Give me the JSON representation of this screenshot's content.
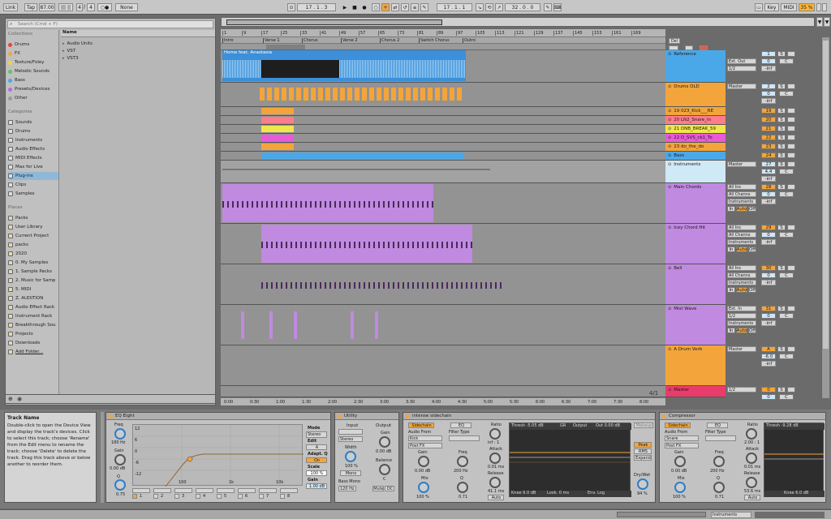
{
  "transport": {
    "link": "Link",
    "tap": "Tap",
    "tempo": "87.00",
    "bars": "||| ||",
    "sig_num": "4",
    "sig_den": "4",
    "metro": "None",
    "position": "17 . 1 . 3",
    "loop_start": "17 . 1 . 1",
    "loop_len": "32 . 0 . 0",
    "key": "Key",
    "midi": "MIDI",
    "cpu": "35 %",
    "accent": "#f3a53b"
  },
  "browser": {
    "search_placeholder": "Search (Cmd + F)",
    "collections_title": "Collections",
    "collections": [
      {
        "label": "Drums",
        "color": "#e8453c"
      },
      {
        "label": "FX",
        "color": "#f3a53b"
      },
      {
        "label": "Texture/Foley",
        "color": "#f0d43a"
      },
      {
        "label": "Melodic Sounds",
        "color": "#5dc461"
      },
      {
        "label": "Bass",
        "color": "#4aa8e8"
      },
      {
        "label": "Presets/Devices",
        "color": "#b070d8"
      },
      {
        "label": "Other",
        "color": "#9a9a9a"
      }
    ],
    "categories_title": "Categories",
    "categories": [
      "Sounds",
      "Drums",
      "Instruments",
      "Audio Effects",
      "MIDI Effects",
      "Max for Live",
      "Plug-ins",
      "Clips",
      "Samples"
    ],
    "places_title": "Places",
    "places": [
      "Packs",
      "User Library",
      "Current Project",
      "packs",
      "2020",
      "0. My Samples",
      "1. Sample Packs",
      "2. Music for Samp",
      "5. MIDI",
      "Z. AUDITION",
      "Audio Effect Rack",
      "Instrument Rack",
      "Breakthrough Sou",
      "Projects",
      "Downloads",
      "Add Folder..."
    ],
    "name_header": "Name",
    "files": [
      "Audio Units",
      "VST",
      "VST3"
    ]
  },
  "ruler": {
    "bars": [
      "1",
      "9",
      "17",
      "25",
      "33",
      "41",
      "49",
      "57",
      "65",
      "73",
      "81",
      "89",
      "97",
      "105",
      "113",
      "121",
      "129",
      "137",
      "145",
      "153",
      "161",
      "169"
    ],
    "locators": [
      "Intro",
      "Verse 1",
      "Chorus",
      "Verse 2",
      "Chorus 2",
      "Switch Chorus",
      "Outro"
    ],
    "times": [
      "0:00",
      "0:30",
      "1:00",
      "1:30",
      "2:00",
      "2:30",
      "3:00",
      "3:30",
      "4:00",
      "4:30",
      "5:00",
      "5:30",
      "6:00",
      "6:30",
      "7:00",
      "7:30",
      "8:00"
    ],
    "page": "4/1"
  },
  "clip_title": "Home feat. Anastasia",
  "tracks": [
    {
      "name": "Reference",
      "color": "#4aa8e8",
      "num": "1",
      "routing": "",
      "sub": "Ext. Out",
      "sub2": "1/2",
      "vol": "0",
      "pan": "C",
      "inf": "-inf"
    },
    {
      "name": "Drums OLD",
      "color": "#f3a53b",
      "num": "2",
      "routing": "Master",
      "vol": "0",
      "pan": "C",
      "inf": "-inf"
    },
    {
      "name": "19 023_Kick___RE",
      "color": "#f3a53b",
      "num": "19"
    },
    {
      "name": "20 LN2_Snare_In",
      "color": "#ff7d8b",
      "num": "20"
    },
    {
      "name": "21 DNB_BREAK_59",
      "color": "#f0e84a",
      "num": "21"
    },
    {
      "name": "22 D_SVS_ck1_To",
      "color": "#e85ad8",
      "num": "22"
    },
    {
      "name": "23 do_the_do",
      "color": "#f3a53b",
      "num": "23"
    },
    {
      "name": "Bass",
      "color": "#4aa8e8",
      "num": "24"
    },
    {
      "name": "Instruments",
      "color": "#cfe9f7",
      "num": "27",
      "routing": "Master",
      "vol": "4.4",
      "pan": "C",
      "inf": "-inf"
    },
    {
      "name": "Main Chords",
      "color": "#c08ae0",
      "num": "28",
      "routing": "All Ins",
      "sub": "All Channs",
      "sub2": "Instruments",
      "vol": "0",
      "pan": "C",
      "inf": "-inf"
    },
    {
      "name": "Icey Chord Hit",
      "color": "#c08ae0",
      "num": "29",
      "routing": "All Ins",
      "sub": "All Channs",
      "sub2": "Instruments",
      "vol": "0",
      "pan": "C",
      "inf": "-inf"
    },
    {
      "name": "Bell",
      "color": "#c08ae0",
      "num": "30",
      "routing": "All Ins",
      "sub": "All Channs",
      "sub2": "Instruments",
      "vol": "0",
      "pan": "C",
      "inf": "-inf"
    },
    {
      "name": "Mist Wave",
      "color": "#c08ae0",
      "num": "31",
      "routing": "Ext. In",
      "sub": "1/2",
      "sub2": "Instruments",
      "vol": "0",
      "pan": "C",
      "inf": "-inf"
    },
    {
      "name": "A Drum Verb",
      "color": "#f3a53b",
      "num": "A",
      "routing": "Master",
      "vol": "-6.0",
      "pan": "C",
      "inf": "-inf"
    },
    {
      "name": "Master",
      "color": "#ea3c6a",
      "num": "0",
      "routing": "1/2",
      "vol": "0",
      "pan": "C"
    }
  ],
  "mixer_labels": {
    "in": "In",
    "auto": "Auto",
    "off": "Off",
    "s": "S",
    "post": "Post"
  },
  "info": {
    "title": "Track Name",
    "body": "Double-click to open the Device View and display the track's devices. Click to select this track; choose 'Rename' from the Edit menu to rename the track; choose 'Delete' to delete the track. Drag this track above or below another to reorder them."
  },
  "eq": {
    "title": "EQ Eight",
    "freq_label": "Freq",
    "freq": "180 Hz",
    "gain_label": "Gain",
    "gain": "0.00 dB",
    "q_label": "Q",
    "q": "0.75",
    "mode_label": "Mode",
    "mode": "Stereo",
    "edit_label": "Edit",
    "edit": "A",
    "adapt_label": "Adapt. Q",
    "adapt": "On",
    "scale_label": "Scale",
    "scale": "100 %",
    "gain2_label": "Gain",
    "gain2": "1.00 dB",
    "grid": [
      "12",
      "6",
      "0",
      "-6",
      "-12"
    ],
    "freqs": [
      "100",
      "1k",
      "10k"
    ],
    "bands": [
      "1",
      "2",
      "3",
      "4",
      "5",
      "6",
      "7",
      "8"
    ]
  },
  "utility": {
    "title": "Utility",
    "input": "Input",
    "output": "Output",
    "stereo": "Stereo",
    "gain_label": "Gain",
    "gain": "0.00 dB",
    "width_label": "Width",
    "width": "100 %",
    "mono": "Mono",
    "balance_label": "Balance",
    "balance": "C",
    "bass_mono": "Bass Mono",
    "bass_freq": "120 Hz",
    "mute": "Mute",
    "dc": "DC"
  },
  "intense": {
    "title": "intense sidechain",
    "sidechain": "Sidechain",
    "eq": "EQ",
    "audio_from": "Audio From",
    "source": "Kick",
    "post": "Post FX",
    "filter_type": "Filter Type",
    "gain_label": "Gain",
    "gain": "0.00 dB",
    "freq_label": "Freq",
    "freq": "200 Hz",
    "mix_label": "Mix",
    "mix": "100 %",
    "q_label": "Q",
    "q": "0.71",
    "ratio_label": "Ratio",
    "ratio": "inf : 1",
    "attack_label": "Attack",
    "attack": "0.01 ms",
    "release_label": "Release",
    "release": "41.1 ms",
    "auto": "Auto",
    "thresh": "Thresh -5.05 dB",
    "gr": "GR",
    "output_lbl": "Output",
    "out": "Out 0.00 dB",
    "makeup": "Makeup",
    "peak": "Peak",
    "rms": "RMS",
    "expand": "Expand",
    "drywet_label": "Dry/Wet",
    "drywet": "94 %",
    "knee": "Knee 6.0 dB",
    "look": "Look. 0 ms",
    "env": "Env. Log"
  },
  "compressor": {
    "title": "Compressor",
    "sidechain": "Sidechain",
    "eq": "EQ",
    "audio_from": "Audio From",
    "source": "Snare",
    "post": "Post FX",
    "filter_type": "Filter Type",
    "gain_label": "Gain",
    "gain": "0.00 dB",
    "freq_label": "Freq",
    "freq": "200 Hz",
    "mix_label": "Mix",
    "mix": "100 %",
    "q_label": "Q",
    "q": "0.71",
    "ratio_label": "Ratio",
    "ratio": "2.00 : 1",
    "attack_label": "Attack",
    "attack": "0.01 ms",
    "release_label": "Release",
    "release": "53.6 ms",
    "auto": "Auto",
    "thresh": "Thresh -9.28 dB",
    "knee": "Knee 6.0 dB"
  },
  "statusbar": {
    "track": "Instruments"
  }
}
